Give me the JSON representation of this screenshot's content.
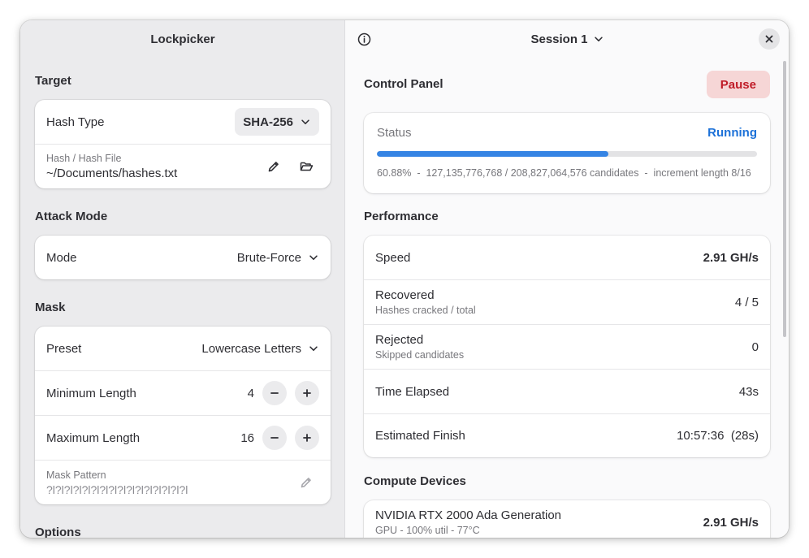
{
  "sidebar": {
    "title": "Lockpicker",
    "target": {
      "section_title": "Target",
      "hash_type_label": "Hash Type",
      "hash_type_value": "SHA-256",
      "hash_file_caption": "Hash / Hash File",
      "hash_file_value": "~/Documents/hashes.txt"
    },
    "attack_mode": {
      "section_title": "Attack Mode",
      "mode_label": "Mode",
      "mode_value": "Brute-Force"
    },
    "mask": {
      "section_title": "Mask",
      "preset_label": "Preset",
      "preset_value": "Lowercase Letters",
      "min_length_label": "Minimum Length",
      "min_length_value": "4",
      "max_length_label": "Maximum Length",
      "max_length_value": "16",
      "pattern_caption": "Mask Pattern",
      "pattern_value": "?l?l?l?l?l?l?l?l?l?l?l?l?l?l?l?l"
    },
    "options": {
      "section_title": "Options"
    }
  },
  "content": {
    "session_title": "Session 1",
    "control_panel": {
      "section_title": "Control Panel",
      "pause_label": "Pause",
      "status_label": "Status",
      "status_value": "Running",
      "progress_fraction": 0.6088,
      "progress_text": "60.88%  -  127,135,776,768 / 208,827,064,576 candidates  -  increment length 8/16"
    },
    "performance": {
      "section_title": "Performance",
      "speed_label": "Speed",
      "speed_value": "2.91 GH/s",
      "recovered_label": "Recovered",
      "recovered_sub": "Hashes cracked / total",
      "recovered_value": "4 / 5",
      "rejected_label": "Rejected",
      "rejected_sub": "Skipped candidates",
      "rejected_value": "0",
      "elapsed_label": "Time Elapsed",
      "elapsed_value": "43s",
      "finish_label": "Estimated Finish",
      "finish_value": "10:57:36  (28s)"
    },
    "devices": {
      "section_title": "Compute Devices",
      "items": [
        {
          "name": "NVIDIA RTX 2000 Ada Generation",
          "detail": "GPU - 100% util - 77°C",
          "speed": "2.91 GH/s"
        }
      ]
    }
  },
  "colors": {
    "accent": "#3584e4",
    "status_running": "#1c71d8",
    "destructive": "#c01c28",
    "destructive_bg": "#f6d6d6"
  }
}
